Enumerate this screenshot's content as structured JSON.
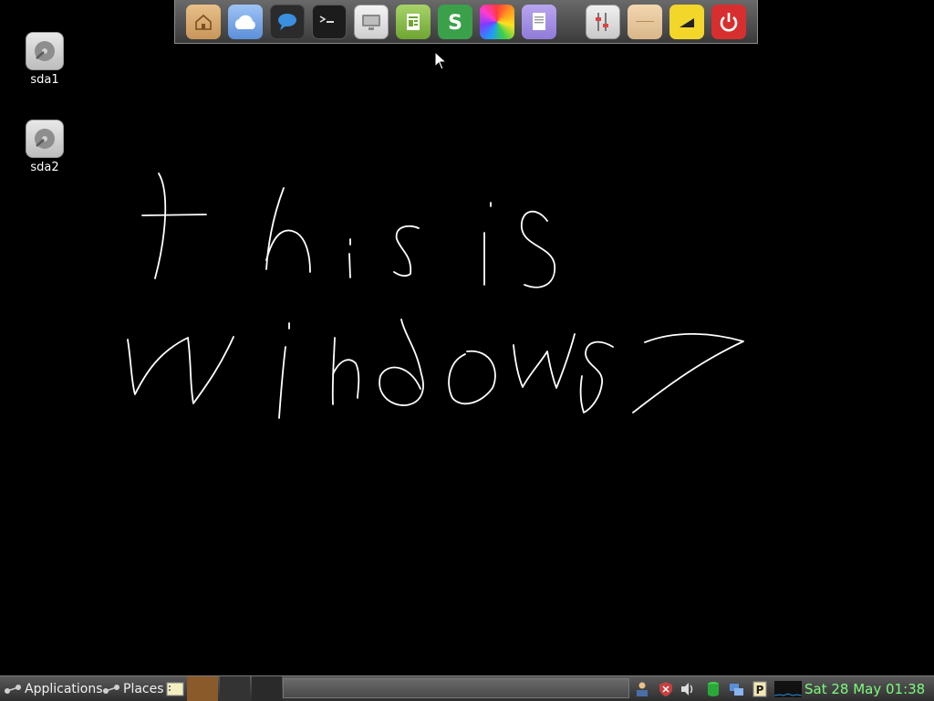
{
  "desktop": {
    "drives": [
      {
        "label": "sda1"
      },
      {
        "label": "sda2"
      }
    ]
  },
  "dock": {
    "items": [
      {
        "icon": "home-folder-icon"
      },
      {
        "icon": "cloud-icon"
      },
      {
        "icon": "chat-bubble-icon"
      },
      {
        "icon": "terminal-icon"
      },
      {
        "icon": "monitor-icon"
      },
      {
        "icon": "document-viewer-icon"
      },
      {
        "icon": "spreadsheet-icon"
      },
      {
        "icon": "color-wheel-icon"
      },
      {
        "icon": "text-editor-icon"
      },
      {
        "icon": "settings-sliders-icon"
      },
      {
        "icon": "files-icon"
      },
      {
        "icon": "brightness-icon"
      },
      {
        "icon": "power-icon"
      }
    ],
    "colors": {
      "power": "#d72f2f",
      "spreadsheet": "#3aa04a",
      "brightness": "#f2d62a"
    }
  },
  "taskbar": {
    "applications_label": "Applications",
    "places_label": "Places",
    "clock": "Sat 28 May 01:38",
    "clock_color": "#7cfc7c"
  }
}
